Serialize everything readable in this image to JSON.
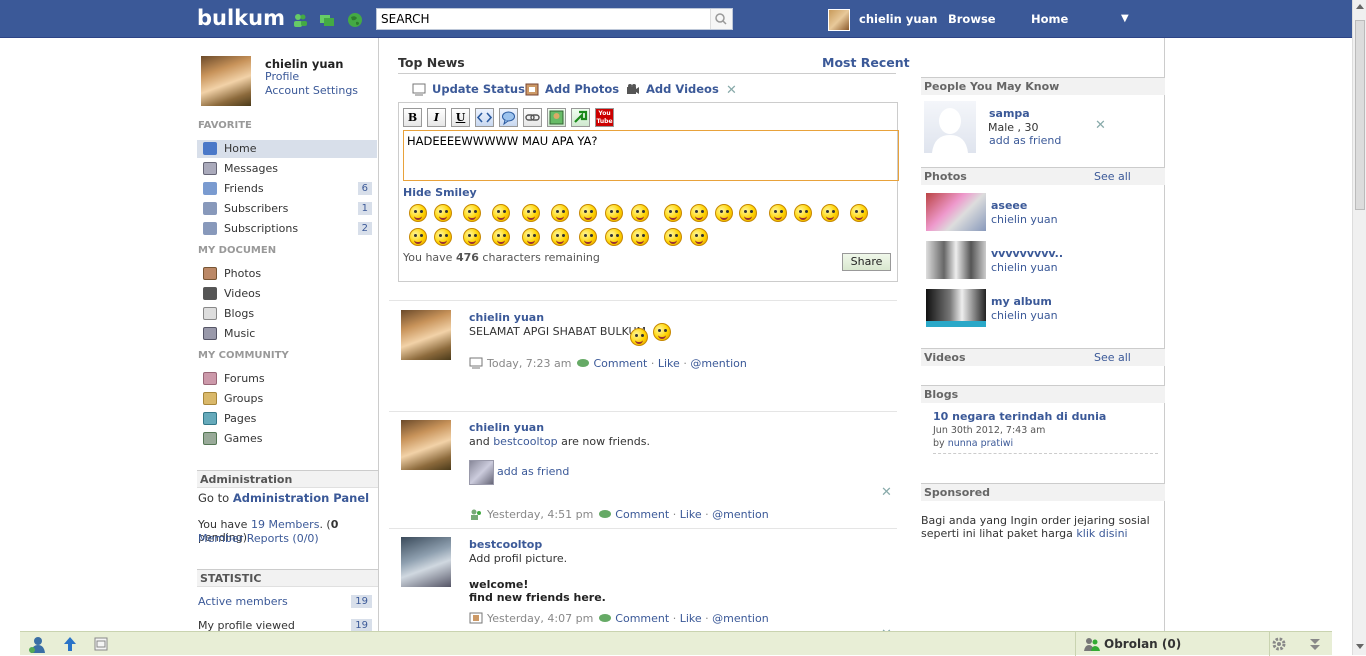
{
  "header": {
    "logo": "bulkum",
    "search_value": "SEARCH",
    "user": "chielin yuan",
    "browse": "Browse",
    "home": "Home",
    "menu_arrow": "▼"
  },
  "left": {
    "user": "chielin yuan",
    "profile": "Profile",
    "account": "Account Settings",
    "favorite": "FAVORITE",
    "fav_items": [
      {
        "label": "Home",
        "count": ""
      },
      {
        "label": "Messages",
        "count": ""
      },
      {
        "label": "Friends",
        "count": "6"
      },
      {
        "label": "Subscribers",
        "count": "1"
      },
      {
        "label": "Subscriptions",
        "count": "2"
      }
    ],
    "mydoc": "MY DOCUMEN",
    "doc_items": [
      "Photos",
      "Videos",
      "Blogs",
      "Music"
    ],
    "mycomm": "MY COMMUNITY",
    "comm_items": [
      "Forums",
      "Groups",
      "Pages",
      "Games"
    ],
    "admin_head": "Administration",
    "goto": "Go to",
    "admin_panel": "Administration Panel",
    "members_pre": "You have",
    "members_count": "19 Members",
    "members_mid": ". (",
    "pending": "0",
    "members_post": " pending)",
    "member_reports": "Member Reports (0/0)",
    "stat_head": "STATISTIC",
    "active_members": "Active members",
    "active_count": "19",
    "profile_viewed": "My profile viewed",
    "viewed_count": "19"
  },
  "center": {
    "top_news": "Top News",
    "most_recent": "Most Recent",
    "tabs": {
      "status": "Update Status",
      "photos": "Add Photos",
      "videos": "Add Videos"
    },
    "close": "✕",
    "toolbar": {
      "bold": "B",
      "italic": "I",
      "underline": "U",
      "youtube": "You Tube"
    },
    "text": "HADEEEEWWWWW MAU APA YA?",
    "hide_smiley": "Hide Smiley",
    "remaining_pre": "You have",
    "remaining_count": "476",
    "remaining_post": "characters remaining",
    "share": "Share",
    "posts": [
      {
        "name": "chielin yuan",
        "text": "SELAMAT APGI SHABAT BULKUM",
        "time": "Today, 7:23 am",
        "comment": "Comment",
        "like": "Like",
        "mention": "@mention"
      },
      {
        "name": "chielin yuan",
        "text_pre": "and",
        "friend": "bestcooltop",
        "text_post": "are now friends.",
        "add": "add as friend",
        "time": "Yesterday, 4:51 pm",
        "comment": "Comment",
        "like": "Like",
        "mention": "@mention"
      },
      {
        "name": "bestcooltop",
        "text": "Add profil picture.",
        "welcome": "welcome!",
        "find": "find new friends here.",
        "time": "Yesterday, 4:07 pm",
        "comment": "Comment",
        "like": "Like",
        "mention": "@mention"
      }
    ],
    "sep": "·"
  },
  "right": {
    "pymk": "People You May Know",
    "pymk_name": "sampa",
    "pymk_info": "Male , 30",
    "pymk_add": "add as friend",
    "photos": "Photos",
    "see_all": "See all",
    "albums": [
      {
        "title": "aseee",
        "owner": "chielin yuan"
      },
      {
        "title": "vvvvvvvvv..",
        "owner": "chielin yuan"
      },
      {
        "title": "my album",
        "owner": "chielin yuan"
      }
    ],
    "videos": "Videos",
    "blogs": "Blogs",
    "blog_title": "10 negara terindah di dunia",
    "blog_date": "Jun 30th 2012, 7:43 am",
    "blog_by": "by",
    "blog_author": "nunna pratiwi",
    "sponsored": "Sponsored",
    "sponsored_text": "Bagi anda yang Ingin order jejaring sosial seperti ini lihat paket harga",
    "klik": "klik disini"
  },
  "bottom": {
    "obrolan": "Obrolan (0)"
  }
}
